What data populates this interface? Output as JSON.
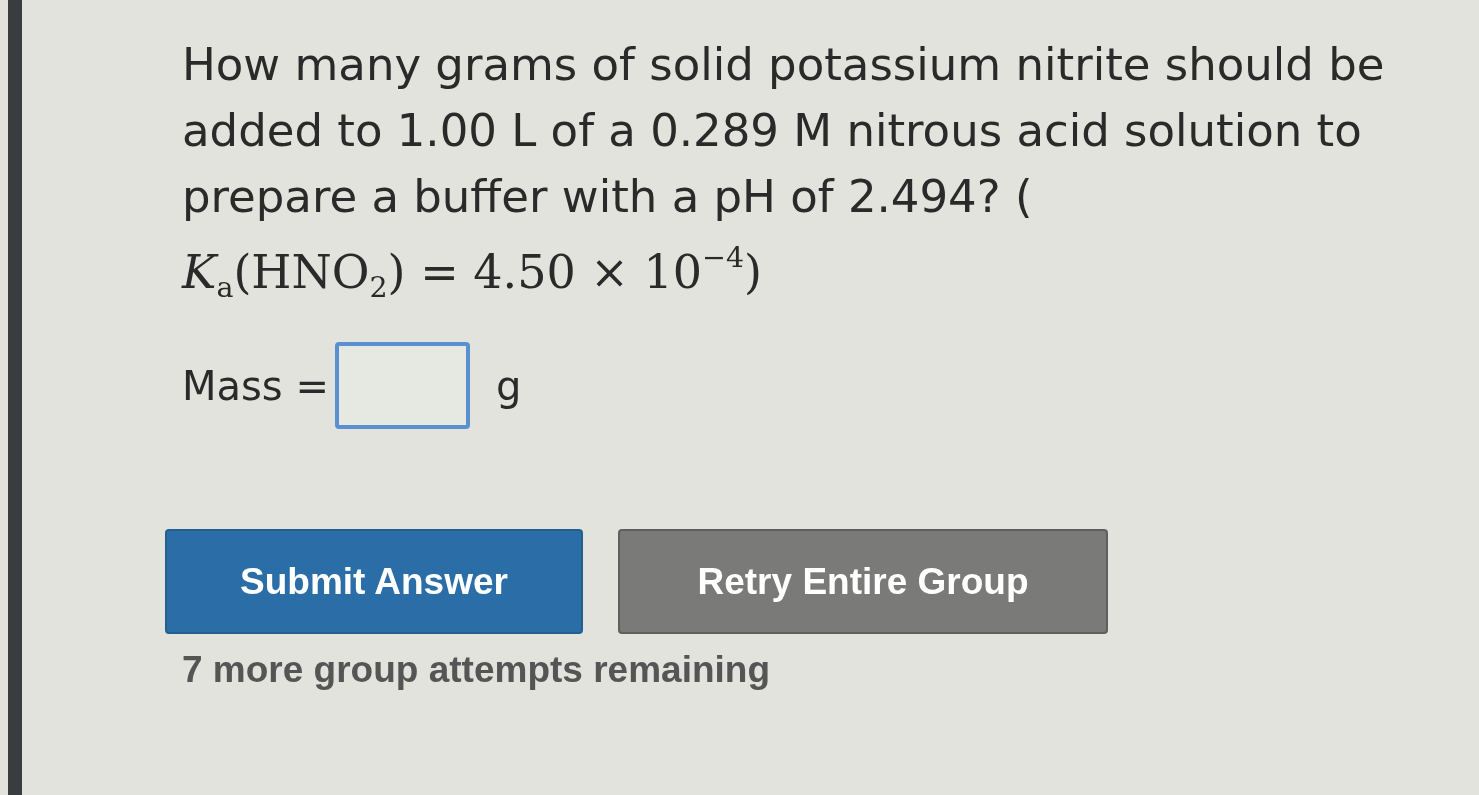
{
  "question": {
    "text": "How many grams of solid potassium nitrite should be added to 1.00 L of a 0.289 M nitrous acid solution to prepare a buffer with a pH of 2.494? (",
    "formula": "*K*$_{a}$(HNO$_{2}$) = 4.50 × 10$^{−4}$)"
  },
  "answer": {
    "label": "Mass =",
    "focused": true,
    "unit": "g"
  },
  "buttons": [
    {
      "label": "Submit Answer",
      "kind": "primary"
    },
    {
      "label": "Retry Entire Group",
      "kind": "secondary"
    }
  ],
  "attempts_note": "7 more group attempts remaining"
}
